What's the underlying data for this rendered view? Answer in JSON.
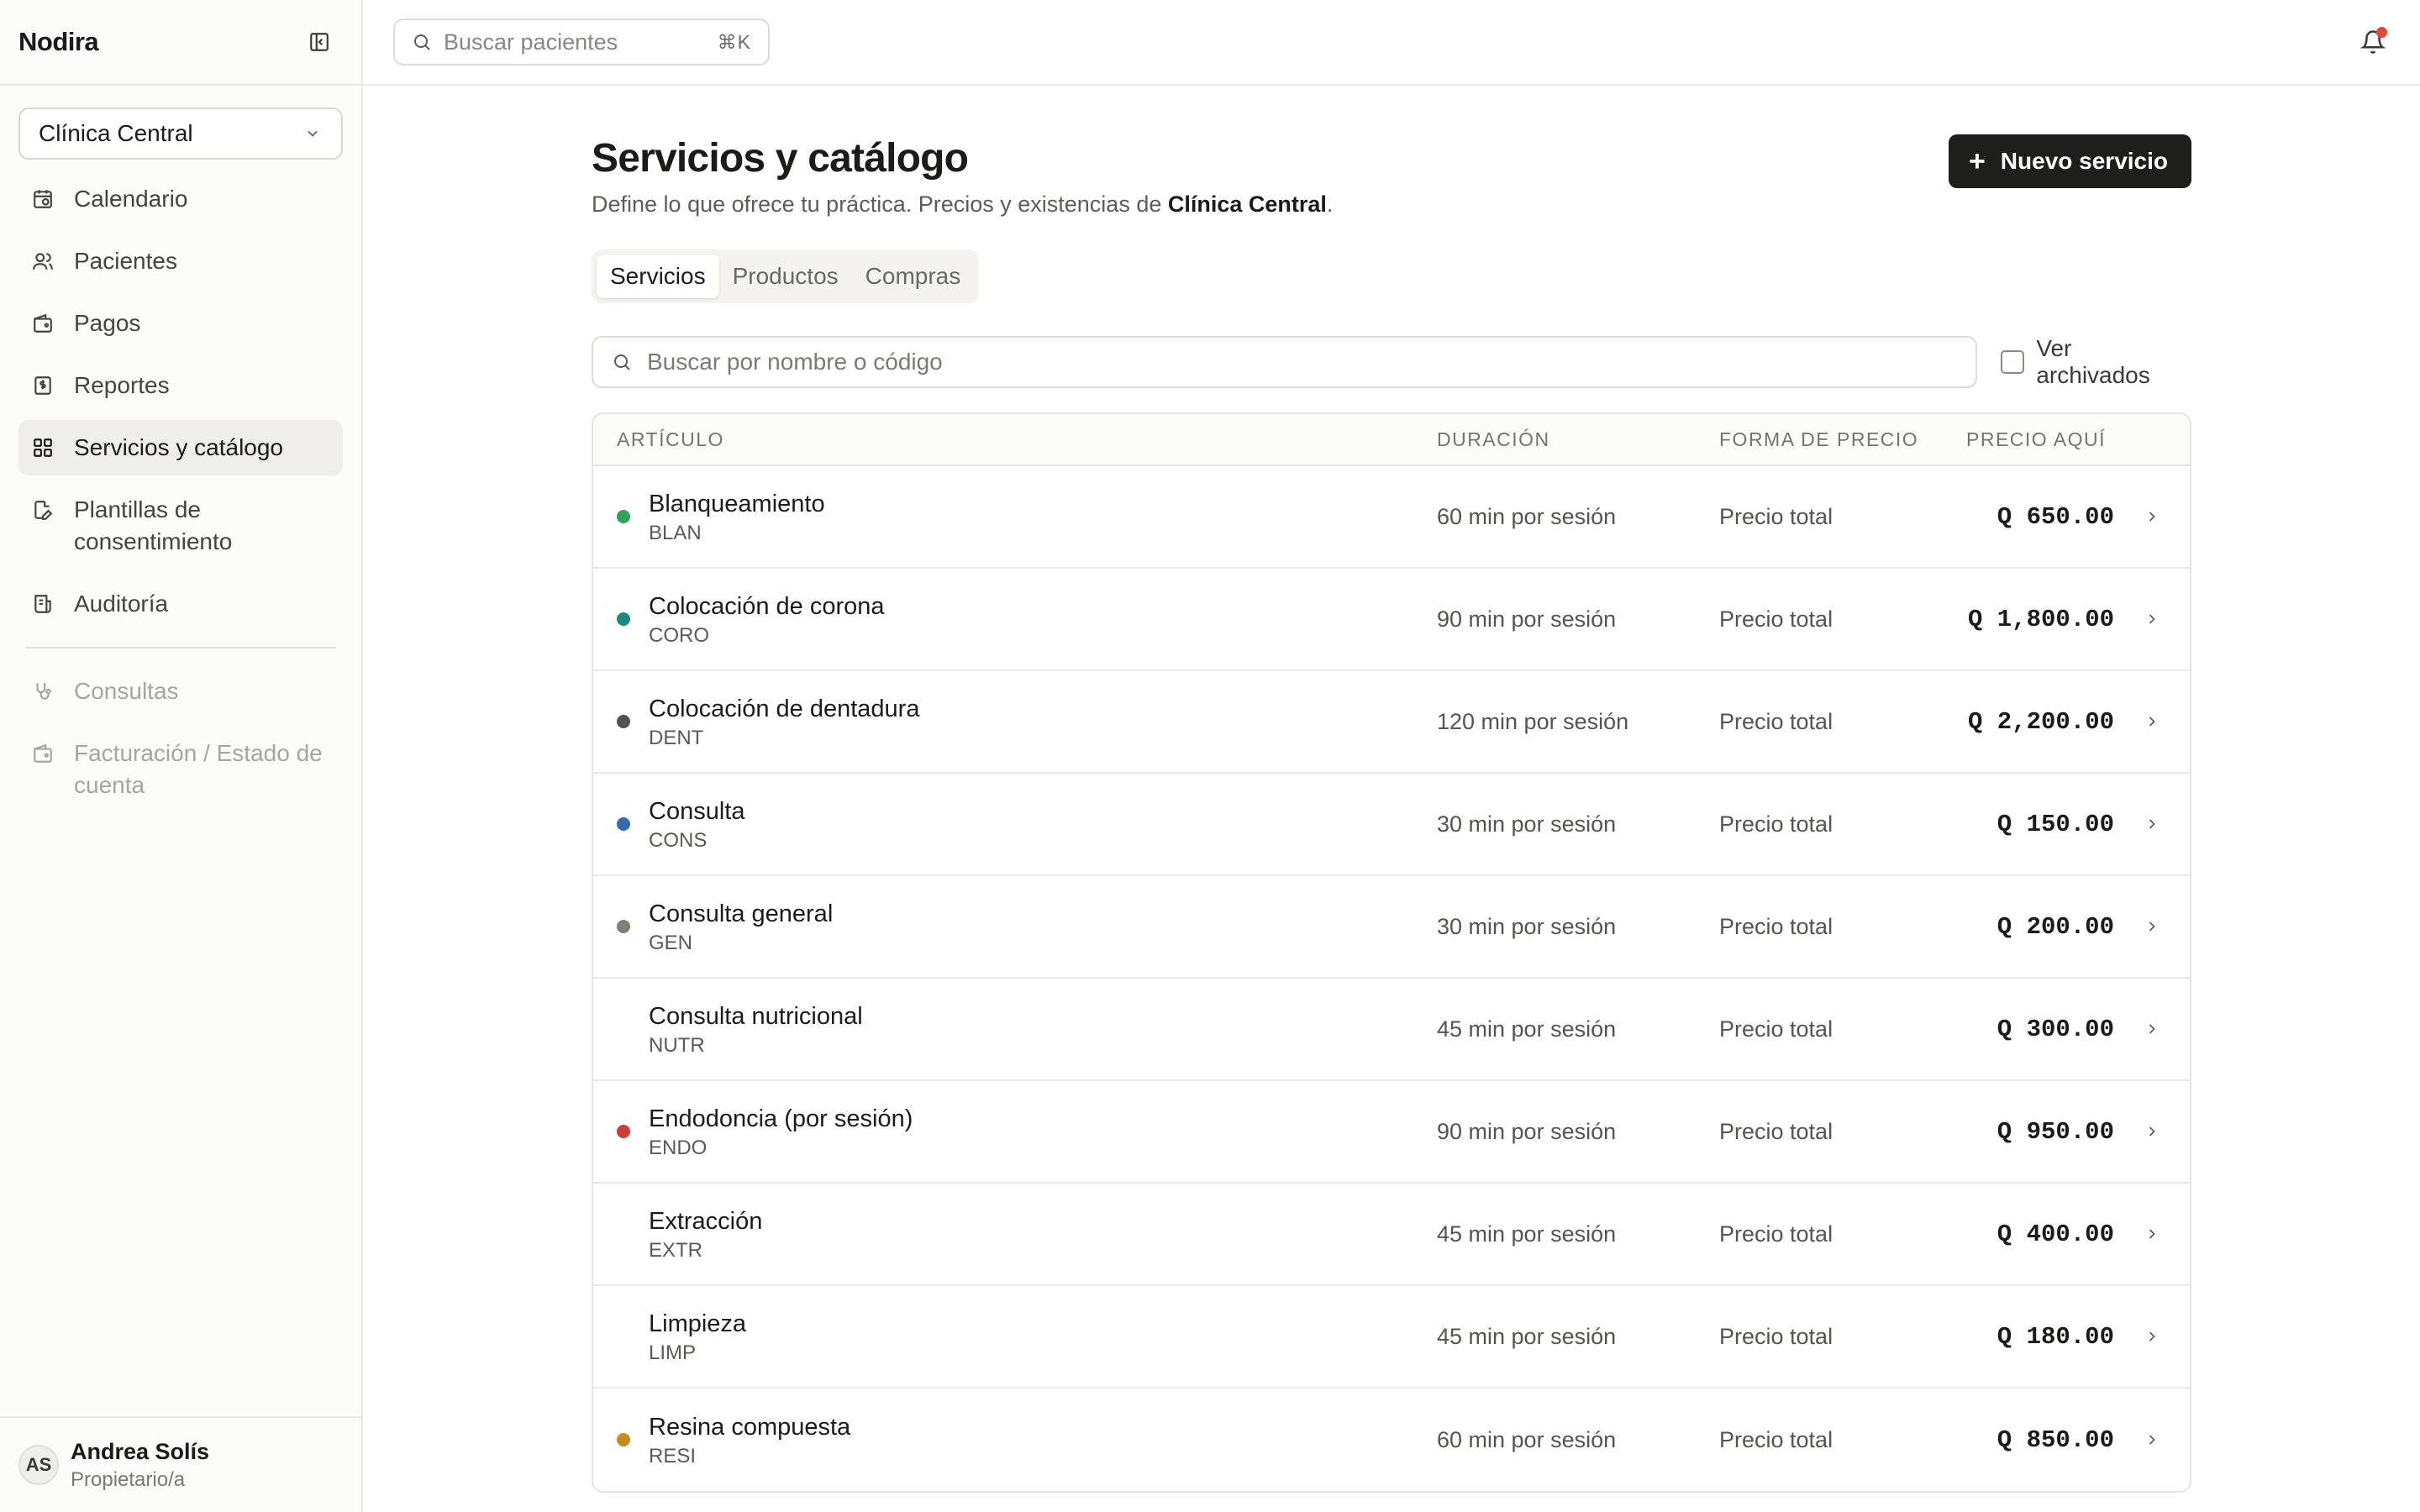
{
  "app": {
    "name": "Nodira"
  },
  "clinic_selector": {
    "value": "Clínica Central"
  },
  "sidebar": {
    "items": [
      {
        "label": "Calendario",
        "icon": "calendar-icon"
      },
      {
        "label": "Pacientes",
        "icon": "users-icon"
      },
      {
        "label": "Pagos",
        "icon": "wallet-icon"
      },
      {
        "label": "Reportes",
        "icon": "dollar-file-icon"
      },
      {
        "label": "Servicios y catálogo",
        "icon": "grid-icon",
        "active": true
      },
      {
        "label": "Plantillas de consentimiento",
        "icon": "edit-file-icon"
      },
      {
        "label": "Auditoría",
        "icon": "audit-icon"
      }
    ],
    "disabled_items": [
      {
        "label": "Consultas",
        "icon": "stethoscope-icon"
      },
      {
        "label": "Facturación / Estado de cuenta",
        "icon": "wallet-icon"
      }
    ]
  },
  "user": {
    "initials": "AS",
    "name": "Andrea Solís",
    "role": "Propietario/a"
  },
  "topbar": {
    "search_placeholder": "Buscar pacientes",
    "shortcut": "⌘K"
  },
  "page": {
    "title": "Servicios y catálogo",
    "subtitle_prefix": "Define lo que ofrece tu práctica. Precios y existencias de ",
    "subtitle_clinic": "Clínica Central",
    "subtitle_suffix": ".",
    "new_button": "Nuevo servicio"
  },
  "tabs": [
    "Servicios",
    "Productos",
    "Compras"
  ],
  "filter": {
    "placeholder": "Buscar por nombre o código",
    "archived_label": "Ver archivados"
  },
  "table": {
    "headers": {
      "articulo": "ARTÍCULO",
      "duracion": "DURACIÓN",
      "forma": "FORMA DE PRECIO",
      "precio": "PRECIO AQUÍ"
    },
    "rows": [
      {
        "name": "Blanqueamiento",
        "code": "BLAN",
        "duration": "60 min por sesión",
        "pricing": "Precio total",
        "price": "Q 650.00",
        "color": "#2ea35a"
      },
      {
        "name": "Colocación de corona",
        "code": "CORO",
        "duration": "90 min por sesión",
        "pricing": "Precio total",
        "price": "Q 1,800.00",
        "color": "#1a8a80"
      },
      {
        "name": "Colocación de dentadura",
        "code": "DENT",
        "duration": "120 min por sesión",
        "pricing": "Precio total",
        "price": "Q 2,200.00",
        "color": "#54524d"
      },
      {
        "name": "Consulta",
        "code": "CONS",
        "duration": "30 min por sesión",
        "pricing": "Precio total",
        "price": "Q 150.00",
        "color": "#2f6db0"
      },
      {
        "name": "Consulta general",
        "code": "GEN",
        "duration": "30 min por sesión",
        "pricing": "Precio total",
        "price": "Q 200.00",
        "color": "#7d8270"
      },
      {
        "name": "Consulta nutricional",
        "code": "NUTR",
        "duration": "45 min por sesión",
        "pricing": "Precio total",
        "price": "Q 300.00",
        "color": ""
      },
      {
        "name": "Endodoncia (por sesión)",
        "code": "ENDO",
        "duration": "90 min por sesión",
        "pricing": "Precio total",
        "price": "Q 950.00",
        "color": "#cf3a3a"
      },
      {
        "name": "Extracción",
        "code": "EXTR",
        "duration": "45 min por sesión",
        "pricing": "Precio total",
        "price": "Q 400.00",
        "color": ""
      },
      {
        "name": "Limpieza",
        "code": "LIMP",
        "duration": "45 min por sesión",
        "pricing": "Precio total",
        "price": "Q 180.00",
        "color": ""
      },
      {
        "name": "Resina compuesta",
        "code": "RESI",
        "duration": "60 min por sesión",
        "pricing": "Precio total",
        "price": "Q 850.00",
        "color": "#c98a1e"
      }
    ]
  }
}
